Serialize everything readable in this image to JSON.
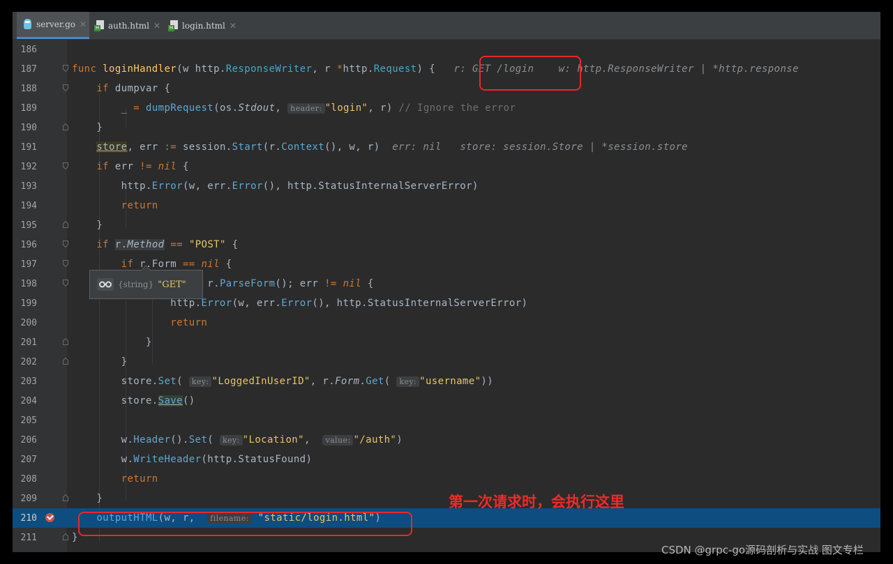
{
  "tabs": [
    {
      "label": "server.go",
      "icon": "go-gopher-icon",
      "active": true
    },
    {
      "label": "auth.html",
      "icon": "html-file-icon",
      "active": false
    },
    {
      "label": "login.html",
      "icon": "html-file-icon",
      "active": false
    }
  ],
  "lines": {
    "l186": "186",
    "l187": "187",
    "l188": "188",
    "l189": "189",
    "l190": "190",
    "l191": "191",
    "l192": "192",
    "l193": "193",
    "l194": "194",
    "l195": "195",
    "l196": "196",
    "l197": "197",
    "l198": "198",
    "l199": "199",
    "l200": "200",
    "l201": "201",
    "l202": "202",
    "l203": "203",
    "l204": "204",
    "l205": "205",
    "l206": "206",
    "l207": "207",
    "l208": "208",
    "l209": "209",
    "l210": "210",
    "l211": "211"
  },
  "inline_hints": {
    "header": "header:",
    "key": "key:",
    "value": "value:",
    "filename": "filename:"
  },
  "debug_values": {
    "line187_r": "r: GET /login",
    "line187_w": "w: http.ResponseWriter | *http.response",
    "line191_err": "err: nil",
    "line191_store": "store: session.Store | *session.store"
  },
  "tooltip": {
    "type": "{string}",
    "value": "\"GET\""
  },
  "annotation": "第一次请求时，会执行这里",
  "watermark": "CSDN @grpc-go源码剖析与实战 图文专栏",
  "colors": {
    "accent_red": "#e8282a",
    "execution_line": "#0d4d7f",
    "editor_bg": "#2b2b2b"
  }
}
